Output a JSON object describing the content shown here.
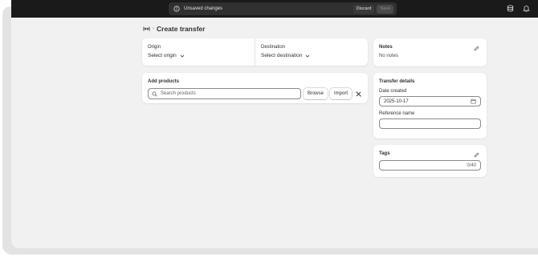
{
  "topbar": {
    "message": "Unsaved changes",
    "discard_label": "Discard",
    "save_label": "Save",
    "icons": [
      "info-icon",
      "database-icon",
      "bell-icon"
    ]
  },
  "page": {
    "title": "Create transfer",
    "breadcrumb_icon": "transfer-icon",
    "breadcrumb_separator": "›"
  },
  "origin": {
    "label": "Origin",
    "value": "Select origin"
  },
  "destination": {
    "label": "Destination",
    "value": "Select destination"
  },
  "products": {
    "label": "Add products",
    "search_placeholder": "Search products",
    "browse_label": "Browse",
    "import_label": "Import"
  },
  "notes": {
    "label": "Notes",
    "value": "No notes"
  },
  "details": {
    "label": "Transfer details",
    "date_label": "Date created",
    "date_value": "2025-10-17",
    "reference_label": "Reference name",
    "reference_value": ""
  },
  "tags": {
    "label": "Tags",
    "counter": "0/40"
  },
  "colors": {
    "topbar": "#1a1a1a",
    "background": "#f1f1f1",
    "card": "#ffffff"
  }
}
